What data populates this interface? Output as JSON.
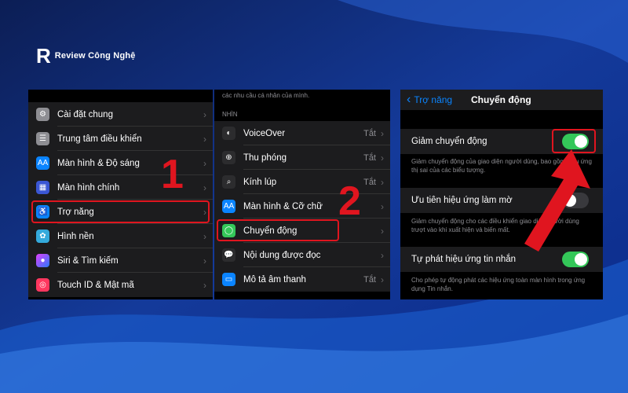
{
  "brand": {
    "logo": "R",
    "name": "Review Công Nghệ"
  },
  "panel1": {
    "items": [
      {
        "label": "Cài đặt chung",
        "icon": "gear-icon",
        "color": "#8e8e93"
      },
      {
        "label": "Trung tâm điều khiển",
        "icon": "toggles-icon",
        "color": "#8e8e93"
      },
      {
        "label": "Màn hình & Độ sáng",
        "icon": "aa-icon",
        "color": "#0a84ff"
      },
      {
        "label": "Màn hình chính",
        "icon": "grid-icon",
        "color": "#3a56d4"
      },
      {
        "label": "Trợ năng",
        "icon": "accessibility-icon",
        "color": "#0a84ff"
      },
      {
        "label": "Hình nền",
        "icon": "flower-icon",
        "color": "#34aadc"
      },
      {
        "label": "Siri & Tìm kiếm",
        "icon": "siri-icon",
        "color": "#2c2c2e"
      },
      {
        "label": "Touch ID & Mật mã",
        "icon": "fingerprint-icon",
        "color": "#ff375f"
      }
    ],
    "step": "1"
  },
  "panel2": {
    "top_text": "các nhu cầu cá nhân của mình.",
    "section": "NHÌN",
    "items": [
      {
        "label": "VoiceOver",
        "value": "Tắt",
        "icon": "voiceover-icon",
        "color": "#2c2c2e"
      },
      {
        "label": "Thu phóng",
        "value": "Tắt",
        "icon": "zoom-icon",
        "color": "#2c2c2e"
      },
      {
        "label": "Kính lúp",
        "value": "Tắt",
        "icon": "magnifier-icon",
        "color": "#2c2c2e"
      },
      {
        "label": "Màn hình & Cỡ chữ",
        "value": "",
        "icon": "aa-icon",
        "color": "#0a84ff"
      },
      {
        "label": "Chuyển động",
        "value": "",
        "icon": "motion-icon",
        "color": "#34c759"
      },
      {
        "label": "Nội dung được đọc",
        "value": "",
        "icon": "speech-bubble-icon",
        "color": "#2c2c2e"
      },
      {
        "label": "Mô tả âm thanh",
        "value": "Tắt",
        "icon": "audio-description-icon",
        "color": "#0a84ff"
      }
    ],
    "step": "2"
  },
  "panel3": {
    "back_label": "Trợ năng",
    "title": "Chuyển động",
    "settings": [
      {
        "label": "Giảm chuyển động",
        "on": true,
        "note": "Giảm chuyển động của giao diện người dùng, bao gồm hiệu ứng thị sai của các biểu tượng."
      },
      {
        "label": "Ưu tiên hiệu ứng làm mờ",
        "on": false,
        "note": "Giảm chuyển động cho các điều khiển giao diện người dùng trượt vào khi xuất hiện và biến mất."
      },
      {
        "label": "Tự phát hiệu ứng tin nhắn",
        "on": true,
        "note": "Cho phép tự động phát các hiệu ứng toàn màn hình trong ứng dụng Tin nhắn."
      }
    ]
  },
  "colors": {
    "highlight": "#e0151f",
    "toggle_on": "#34c759"
  }
}
